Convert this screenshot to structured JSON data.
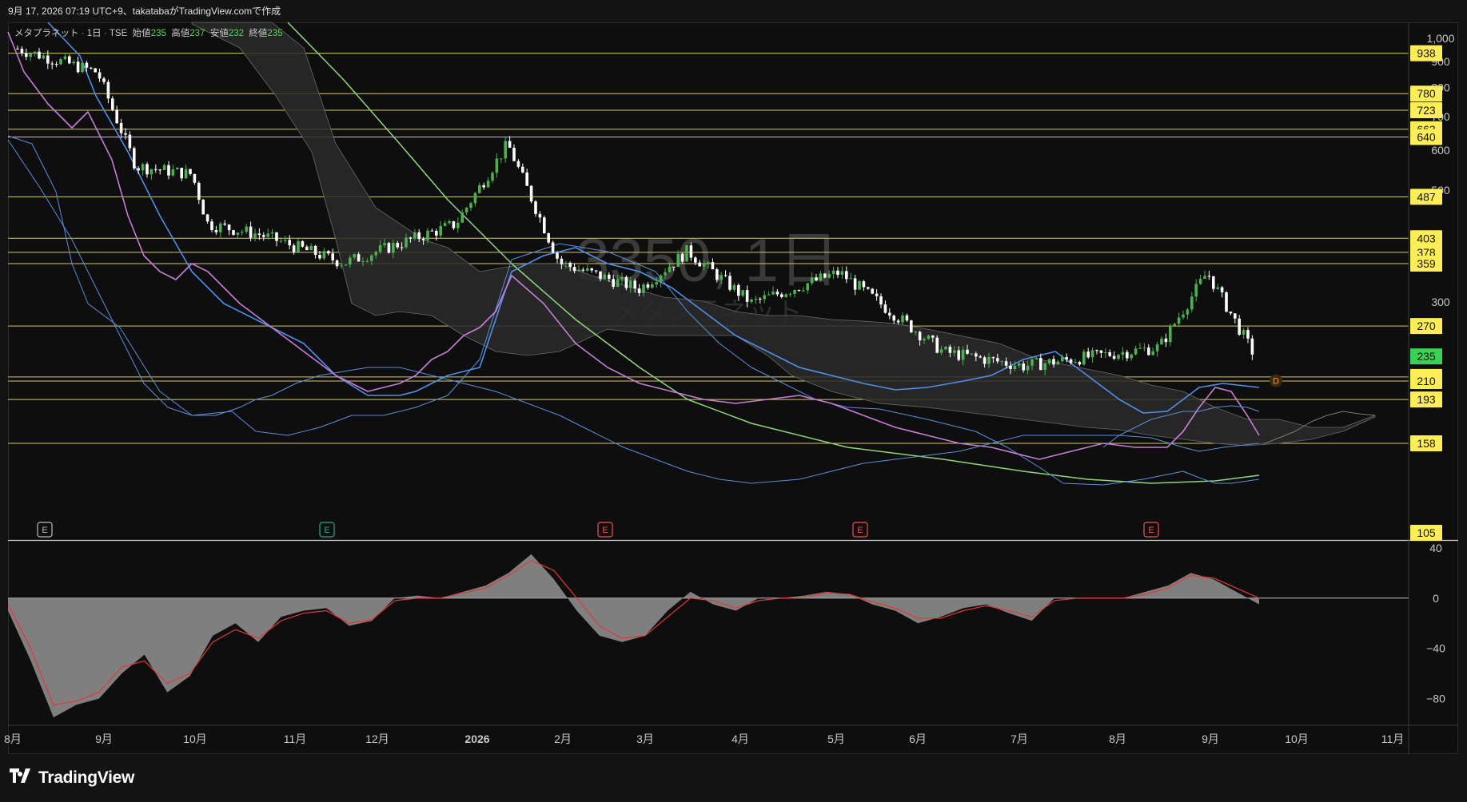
{
  "header": {
    "caption": "9月 17, 2026 07:19 UTC+9、takatabaがTradingView.comで作成"
  },
  "legend": {
    "name": "メタプラネット",
    "interval": "1日",
    "exchange": "TSE",
    "open_label": "始値",
    "open": "235",
    "high_label": "高値",
    "high": "237",
    "low_label": "安値",
    "low": "232",
    "close_label": "終値",
    "close": "235"
  },
  "watermark": {
    "symbol": "3350, 1日",
    "name": "メタプラネット"
  },
  "branding": {
    "logo": "TradingView"
  },
  "colors": {
    "background": "#0e0e0e",
    "up_candle": "#4caf50",
    "down_candle": "#ffffff",
    "hline": "#d8c860",
    "price_label_bg": "#ffee58",
    "current_price_bg": "#39d353",
    "ma_fast": "#c77dd8",
    "ma_mid": "#4f8fe8",
    "ma_slow": "#8fd67a",
    "band": "#5a8fd8",
    "oscillator_fill": "#8c8c8c",
    "signal": "#e03a3a"
  },
  "chart_data": [
    {
      "type": "candlestick",
      "title": "メタプラネット · 1日 · TSE",
      "scale": "log",
      "ylim": [
        102,
        1080
      ],
      "y_ticks": [
        1000,
        900,
        800,
        700,
        600,
        500,
        300
      ],
      "x_ticks": [
        "8月",
        "9月",
        "10月",
        "11月",
        "12月",
        "2026",
        "2月",
        "3月",
        "4月",
        "5月",
        "6月",
        "7月",
        "8月",
        "9月",
        "10月",
        "11月"
      ],
      "price_levels": [
        938,
        780,
        723,
        663,
        640,
        487,
        403,
        378,
        359,
        270,
        214,
        210,
        193,
        158,
        105
      ],
      "current_price": 235,
      "earnings_markers": [
        "E",
        "E",
        "E",
        "E",
        "E"
      ],
      "dividend_marker": "D",
      "close_path": [
        {
          "x": "8月",
          "y": 960
        },
        {
          "x": "9月",
          "y": 860
        },
        {
          "x": "9月",
          "y": 560
        },
        {
          "x": "10月",
          "y": 540
        },
        {
          "x": "10月",
          "y": 430
        },
        {
          "x": "11月",
          "y": 410
        },
        {
          "x": "12月",
          "y": 360
        },
        {
          "x": "2026",
          "y": 430
        },
        {
          "x": "2026",
          "y": 620
        },
        {
          "x": "2月",
          "y": 360
        },
        {
          "x": "3月",
          "y": 320
        },
        {
          "x": "3月",
          "y": 380
        },
        {
          "x": "4月",
          "y": 300
        },
        {
          "x": "5月",
          "y": 345
        },
        {
          "x": "6月",
          "y": 240
        },
        {
          "x": "7月",
          "y": 225
        },
        {
          "x": "8月",
          "y": 245
        },
        {
          "x": "9月",
          "y": 345
        },
        {
          "x": "9月",
          "y": 235
        }
      ]
    },
    {
      "type": "area",
      "title": "oscillator",
      "ylim": [
        -100,
        45
      ],
      "y_ticks": [
        40,
        0,
        -40,
        -80
      ],
      "series": [
        {
          "values": [
            -10,
            -50,
            -95,
            -85,
            -80,
            -60,
            -45,
            -75,
            -62,
            -30,
            -20,
            -35,
            -15,
            -10,
            -8,
            -22,
            -18,
            0,
            2,
            0,
            5,
            10,
            20,
            35,
            15,
            -10,
            -30,
            -35,
            -30,
            -10,
            5,
            -5,
            -10,
            0,
            0,
            2,
            5,
            3,
            -5,
            -10,
            -20,
            -15,
            -8,
            -5,
            -12,
            -18,
            0,
            0,
            0,
            0,
            5,
            10,
            20,
            15,
            5,
            -5
          ]
        },
        {
          "values": [
            -5,
            -40,
            -85,
            -82,
            -75,
            -55,
            -50,
            -68,
            -60,
            -35,
            -25,
            -32,
            -18,
            -12,
            -10,
            -20,
            -17,
            -2,
            0,
            0,
            4,
            8,
            18,
            30,
            22,
            0,
            -22,
            -32,
            -30,
            -15,
            0,
            -2,
            -8,
            -2,
            0,
            1,
            4,
            3,
            -3,
            -8,
            -16,
            -16,
            -10,
            -6,
            -10,
            -15,
            -2,
            0,
            0,
            0,
            3,
            8,
            18,
            16,
            8,
            0
          ]
        }
      ]
    }
  ]
}
